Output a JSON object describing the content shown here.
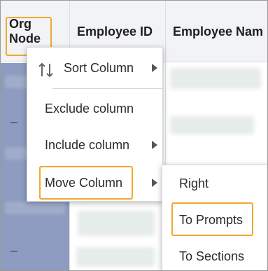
{
  "grid": {
    "columns": [
      {
        "label_line1": "Org",
        "label_line2": "Node"
      },
      {
        "label": "Employee ID"
      },
      {
        "label": "Employee Nam"
      }
    ]
  },
  "context_menu": {
    "items": [
      {
        "label": "Sort Column",
        "icon": "sort-arrows-icon",
        "has_submenu": true
      },
      {
        "label": "Exclude column",
        "has_submenu": false
      },
      {
        "label": "Include column",
        "has_submenu": true
      },
      {
        "label": "Move Column",
        "has_submenu": true,
        "highlighted": true
      }
    ]
  },
  "submenu": {
    "items": [
      {
        "label": "Right"
      },
      {
        "label": "To Prompts",
        "highlighted": true
      },
      {
        "label": "To Sections"
      }
    ]
  },
  "colors": {
    "highlight": "#f0a830",
    "header_bg": "#f2f3f5",
    "org_column_bg": "#8d9cc0"
  }
}
